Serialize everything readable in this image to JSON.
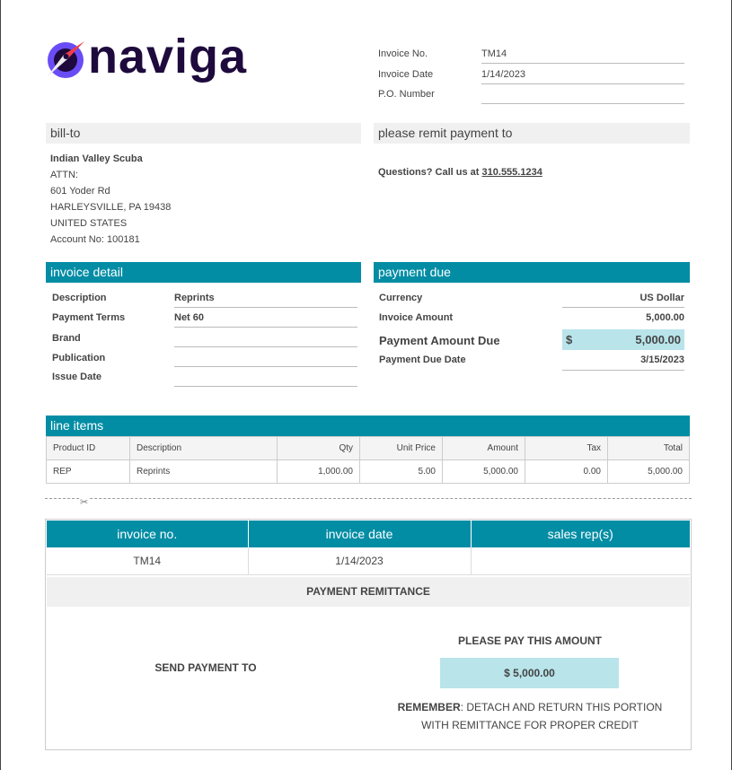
{
  "logo": {
    "text": "naviga"
  },
  "header": {
    "invoice_no_label": "Invoice No.",
    "invoice_no": "TM14",
    "invoice_date_label": "Invoice Date",
    "invoice_date": "1/14/2023",
    "po_label": "P.O. Number",
    "po": ""
  },
  "bill_to": {
    "title": "bill-to",
    "name": "Indian Valley Scuba",
    "attn": "ATTN:",
    "street": "601 Yoder Rd",
    "city": "HARLEYSVILLE, PA 19438",
    "country": "UNITED STATES",
    "account": "Account No: 100181"
  },
  "remit": {
    "title": "please remit payment to",
    "questions": "Questions? Call us at",
    "phone": "310.555.1234"
  },
  "invoice_detail": {
    "title": "invoice detail",
    "rows": [
      {
        "label": "Description",
        "value": "Reprints"
      },
      {
        "label": "Payment Terms",
        "value": "Net 60"
      },
      {
        "label": "Brand",
        "value": ""
      },
      {
        "label": "Publication",
        "value": ""
      },
      {
        "label": "Issue Date",
        "value": ""
      }
    ]
  },
  "payment_due": {
    "title": "payment due",
    "currency_label": "Currency",
    "currency": "US Dollar",
    "invoice_amount_label": "Invoice Amount",
    "invoice_amount": "5,000.00",
    "amount_due_label": "Payment Amount Due",
    "amount_due_symbol": "$",
    "amount_due": "5,000.00",
    "due_date_label": "Payment Due Date",
    "due_date": "3/15/2023"
  },
  "line_items": {
    "title": "line items",
    "columns": [
      "Product ID",
      "Description",
      "Qty",
      "Unit Price",
      "Amount",
      "Tax",
      "Total"
    ],
    "rows": [
      [
        "REP",
        "Reprints",
        "1,000.00",
        "5.00",
        "5,000.00",
        "0.00",
        "5,000.00"
      ]
    ]
  },
  "remittance": {
    "columns": [
      "invoice no.",
      "invoice date",
      "sales rep(s)"
    ],
    "values": [
      "TM14",
      "1/14/2023",
      ""
    ],
    "banner": "PAYMENT REMITTANCE",
    "send_to": "SEND PAYMENT TO",
    "pay_label": "PLEASE PAY THIS AMOUNT",
    "pay_amount": "$ 5,000.00",
    "remember_bold": "REMEMBER",
    "remember_text": ": DETACH AND RETURN THIS PORTION",
    "remember_text2": "WITH REMITTANCE FOR PROPER CREDIT"
  },
  "colors": {
    "teal": "#038da5",
    "highlight": "#b8e4ea",
    "brand_purple": "#1e0a3c",
    "brand_violet": "#6a4cf5",
    "brand_red": "#ef3e4a"
  }
}
